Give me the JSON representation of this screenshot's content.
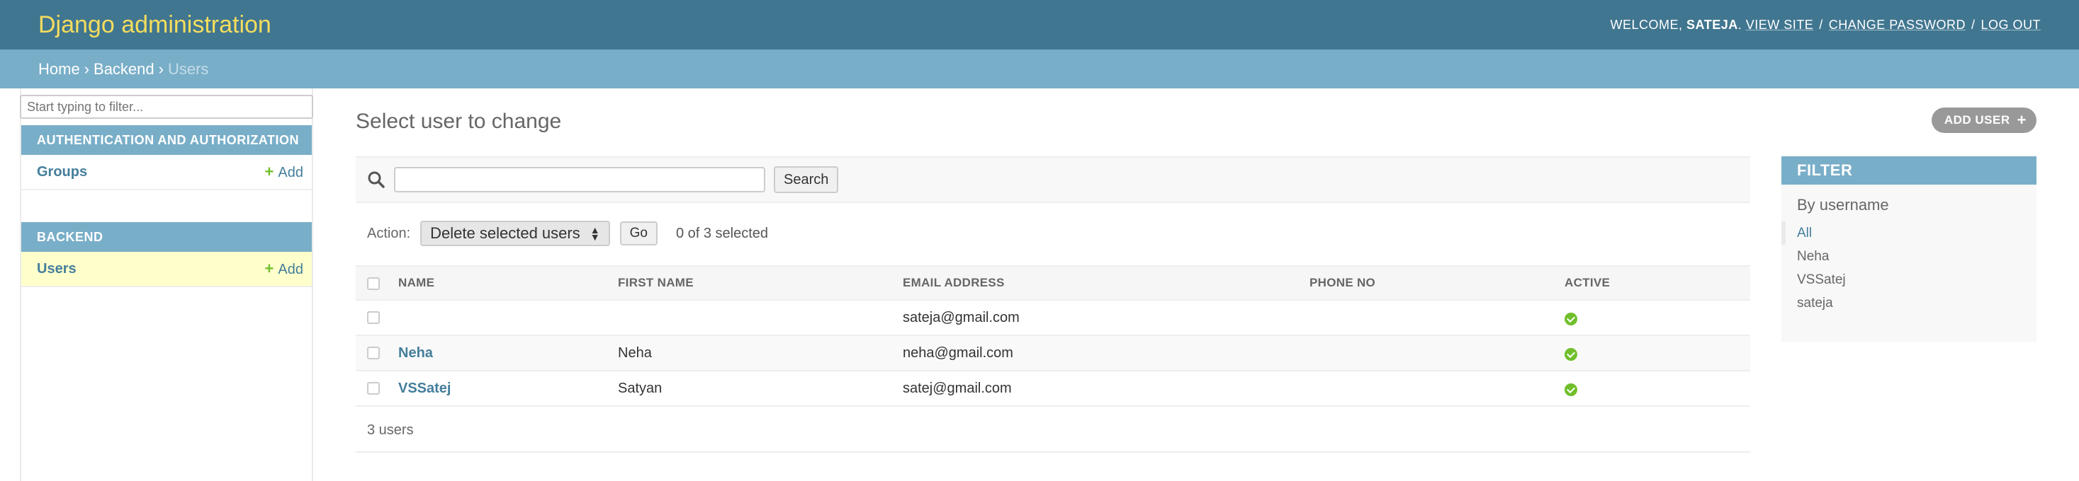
{
  "header": {
    "branding": "Django administration",
    "welcome": "WELCOME,",
    "username": "SATEJA",
    "view_site": "VIEW SITE",
    "change_password": "CHANGE PASSWORD",
    "log_out": "LOG OUT"
  },
  "breadcrumbs": {
    "home": "Home",
    "app": "Backend",
    "current": "Users"
  },
  "sidebar": {
    "filter_placeholder": "Start typing to filter...",
    "modules": [
      {
        "caption": "AUTHENTICATION AND AUTHORIZATION",
        "rows": [
          {
            "label": "Groups",
            "add": "Add"
          }
        ]
      },
      {
        "caption": "BACKEND",
        "rows": [
          {
            "label": "Users",
            "add": "Add"
          }
        ]
      }
    ]
  },
  "content": {
    "title": "Select user to change",
    "add_user": "ADD USER",
    "search_button": "Search",
    "action_label": "Action:",
    "action_selected": "Delete selected users",
    "go_button": "Go",
    "counter": "0 of 3 selected",
    "columns": [
      "NAME",
      "FIRST NAME",
      "EMAIL ADDRESS",
      "PHONE NO",
      "ACTIVE"
    ],
    "rows": [
      {
        "name": "",
        "first_name": "",
        "email": "sateja@gmail.com",
        "phone": "",
        "active": true
      },
      {
        "name": "Neha",
        "first_name": "Neha",
        "email": "neha@gmail.com",
        "phone": "",
        "active": true
      },
      {
        "name": "VSSatej",
        "first_name": "Satyan",
        "email": "satej@gmail.com",
        "phone": "",
        "active": true
      }
    ],
    "paginator": "3 users"
  },
  "filter": {
    "title": "FILTER",
    "subtitle": "By username",
    "options": [
      "All",
      "Neha",
      "VSSatej",
      "sateja"
    ],
    "selected": "All"
  },
  "colors": {
    "header_bg": "#417690",
    "branding": "#f5dd5d",
    "breadcrumb_bg": "#79aec8",
    "link": "#447e9b",
    "add_plus": "#70bf2b",
    "current_row": "#ffffcc"
  }
}
